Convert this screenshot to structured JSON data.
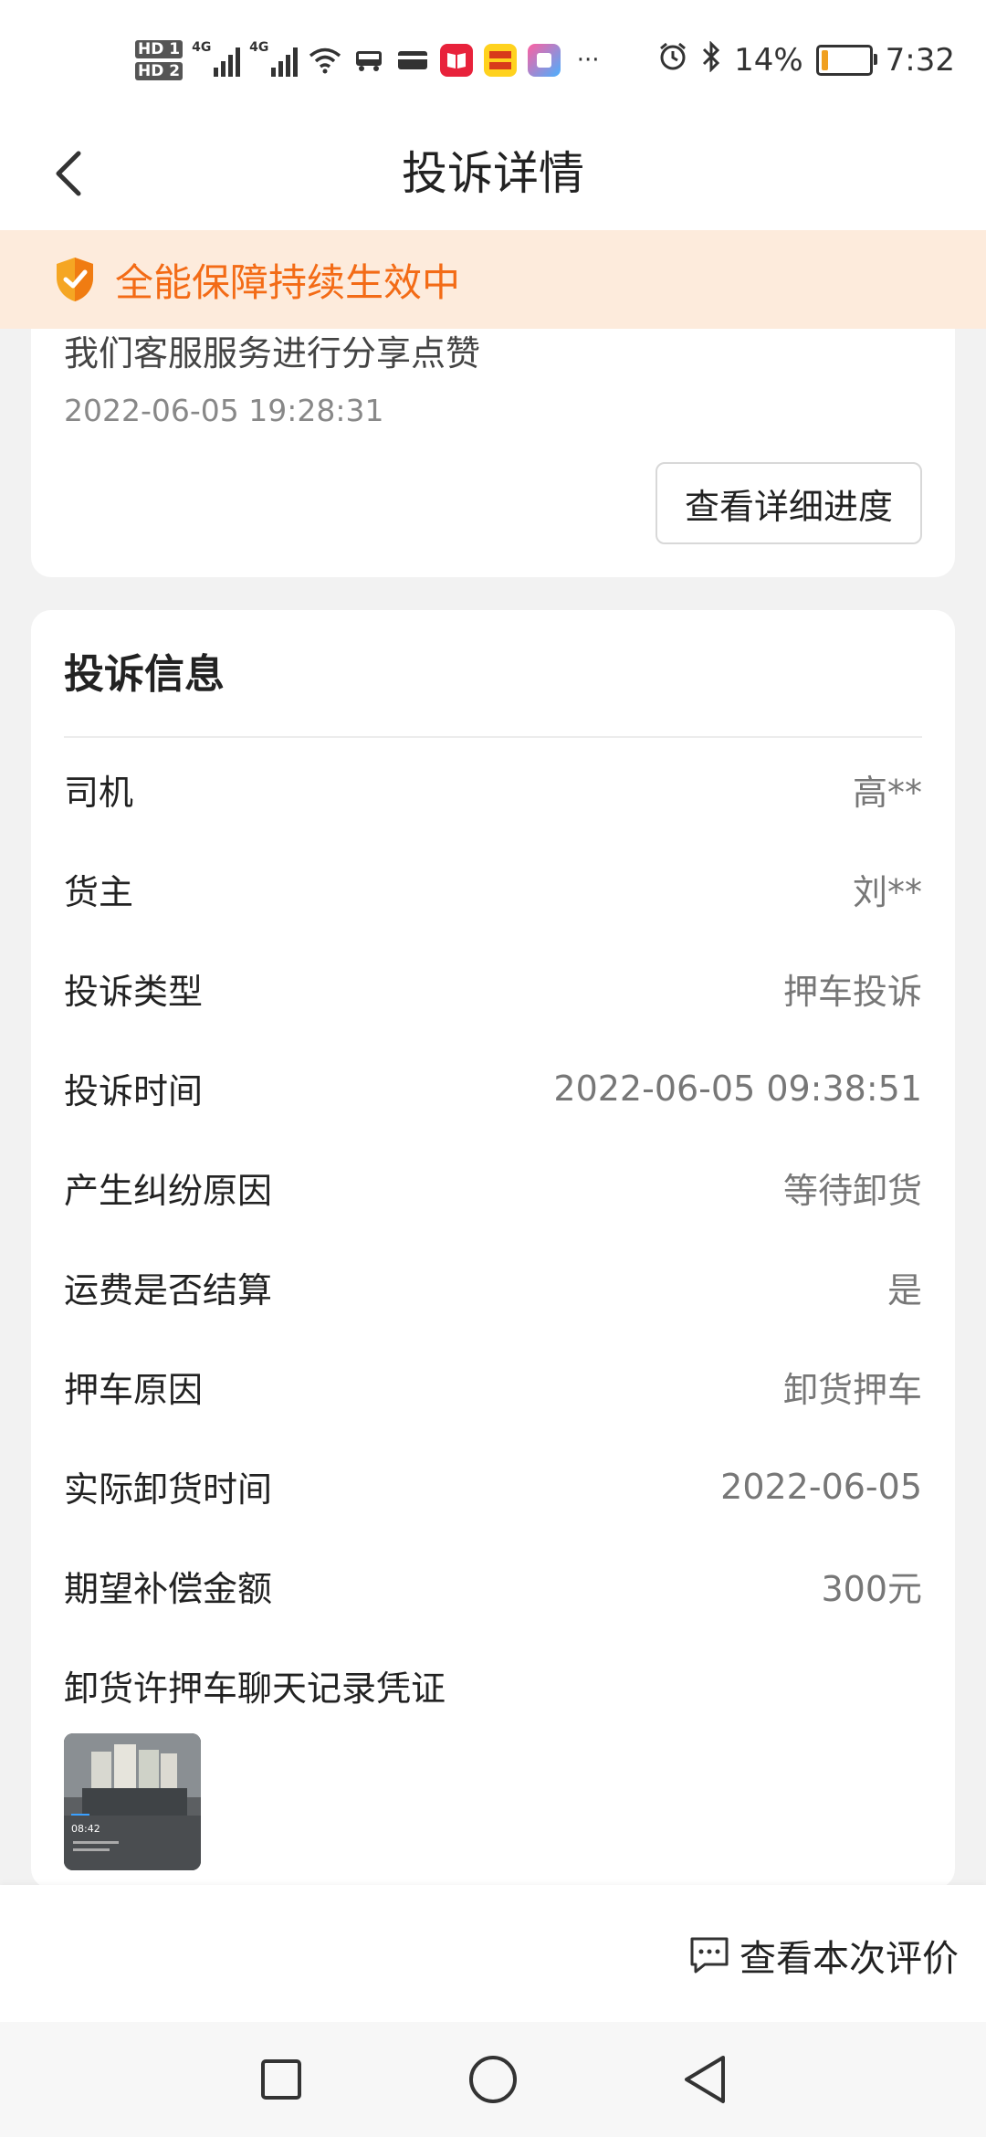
{
  "status_bar": {
    "hd1": "HD 1",
    "hd2": "HD 2",
    "net1": "4G",
    "net2": "4G",
    "more": "···",
    "battery_percent": "14%",
    "battery_level": 0.14,
    "time": "7:32"
  },
  "header": {
    "title": "投诉详情"
  },
  "banner": {
    "text": "全能保障持续生效中"
  },
  "progress_card": {
    "description": "我们客服服务进行分享点赞",
    "timestamp": "2022-06-05 19:28:31",
    "detail_button": "查看详细进度"
  },
  "info": {
    "title": "投诉信息",
    "rows": [
      {
        "label": "司机",
        "value": "高**"
      },
      {
        "label": "货主",
        "value": "刘**"
      },
      {
        "label": "投诉类型",
        "value": "押车投诉"
      },
      {
        "label": "投诉时间",
        "value": "2022-06-05 09:38:51"
      },
      {
        "label": "产生纠纷原因",
        "value": "等待卸货"
      },
      {
        "label": "运费是否结算",
        "value": "是"
      },
      {
        "label": "押车原因",
        "value": "卸货押车"
      },
      {
        "label": "实际卸货时间",
        "value": "2022-06-05"
      },
      {
        "label": "期望补偿金额",
        "value": "300元"
      }
    ],
    "evidence_label": "卸货许押车聊天记录凭证",
    "thumb_time": "08:42"
  },
  "action_bar": {
    "view_rating": "查看本次评价"
  },
  "colors": {
    "accent": "#f36b16",
    "banner_bg": "#fdebdc"
  }
}
